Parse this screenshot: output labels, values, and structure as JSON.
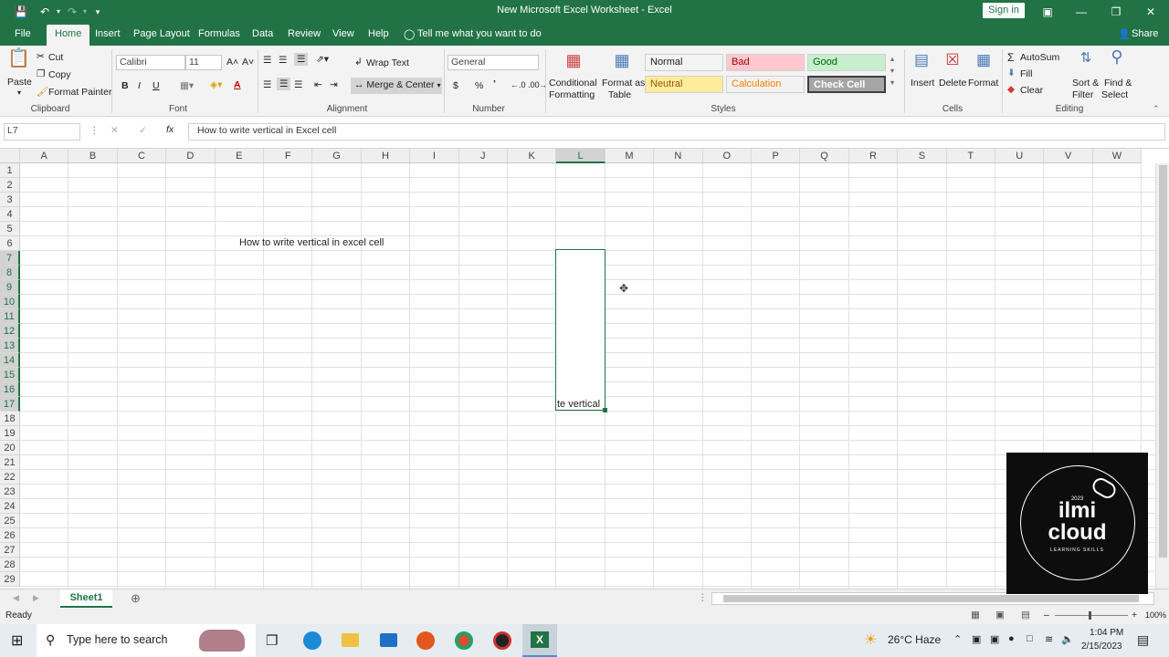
{
  "window": {
    "title": "New Microsoft Excel Worksheet  -  Excel",
    "signin": "Sign in",
    "share": "Share"
  },
  "tabs": [
    "File",
    "Home",
    "Insert",
    "Page Layout",
    "Formulas",
    "Data",
    "Review",
    "View",
    "Help"
  ],
  "tell_me": "Tell me what you want to do",
  "ribbon": {
    "clipboard": {
      "paste": "Paste",
      "cut": "Cut",
      "copy": "Copy",
      "format_painter": "Format Painter",
      "label": "Clipboard"
    },
    "font": {
      "name": "Calibri",
      "size": "11",
      "label": "Font",
      "bold": "B",
      "italic": "I",
      "underline": "U",
      "grow": "A˄",
      "shrink": "A˅"
    },
    "alignment": {
      "wrap_text": "Wrap Text",
      "merge_center": "Merge & Center",
      "label": "Alignment"
    },
    "number": {
      "format": "General",
      "currency": "$",
      "percent": "%",
      "comma": "’",
      "label": "Number"
    },
    "styles": {
      "conditional": "Conditional",
      "formatting": "Formatting",
      "format_as": "Format as",
      "table": "Table",
      "label": "Styles",
      "cells": [
        {
          "name": "Normal",
          "bg": "#ffffff",
          "fg": "#000000"
        },
        {
          "name": "Bad",
          "bg": "#ffc7ce",
          "fg": "#9c0006"
        },
        {
          "name": "Good",
          "bg": "#c6efce",
          "fg": "#006100"
        },
        {
          "name": "Neutral",
          "bg": "#ffeb9c",
          "fg": "#9c5700"
        },
        {
          "name": "Calculation",
          "bg": "#f2f2f2",
          "fg": "#fa7d00"
        },
        {
          "name": "Check Cell",
          "bg": "#a5a5a5",
          "fg": "#ffffff"
        }
      ]
    },
    "cells": {
      "insert": "Insert",
      "delete": "Delete",
      "format": "Format",
      "label": "Cells"
    },
    "editing": {
      "autosum": "AutoSum",
      "fill": "Fill",
      "clear": "Clear",
      "sort": "Sort &",
      "filter": "Filter",
      "find": "Find &",
      "select": "Select",
      "label": "Editing"
    }
  },
  "formula_bar": {
    "name_box": "L7",
    "fx": "fx",
    "value": "How to write vertical in Excel cell"
  },
  "grid": {
    "columns": [
      "A",
      "B",
      "C",
      "D",
      "E",
      "F",
      "G",
      "H",
      "I",
      "J",
      "K",
      "L",
      "M",
      "N",
      "O",
      "P",
      "Q",
      "R",
      "S",
      "T",
      "U",
      "V",
      "W"
    ],
    "rows": [
      "1",
      "2",
      "3",
      "4",
      "5",
      "6",
      "7",
      "8",
      "9",
      "10",
      "11",
      "12",
      "13",
      "14",
      "15",
      "16",
      "17",
      "18",
      "19",
      "20",
      "21",
      "22",
      "23",
      "24",
      "25",
      "26",
      "27",
      "28",
      "29"
    ],
    "cell_e6": "How to write vertical in excel cell",
    "cell_l7": "te vertical"
  },
  "sheet": {
    "name": "Sheet1"
  },
  "status": {
    "ready": "Ready",
    "zoom": "100%"
  },
  "taskbar": {
    "search": "Type here to search",
    "weather": "26°C  Haze",
    "time": "1:04 PM",
    "date": "2/15/2023"
  },
  "logo": {
    "year": "2023",
    "line1": "ilmi",
    "line2": "cloud",
    "tagline": "LEARNING SKILLS"
  },
  "colors": {
    "excel_green": "#217346"
  }
}
